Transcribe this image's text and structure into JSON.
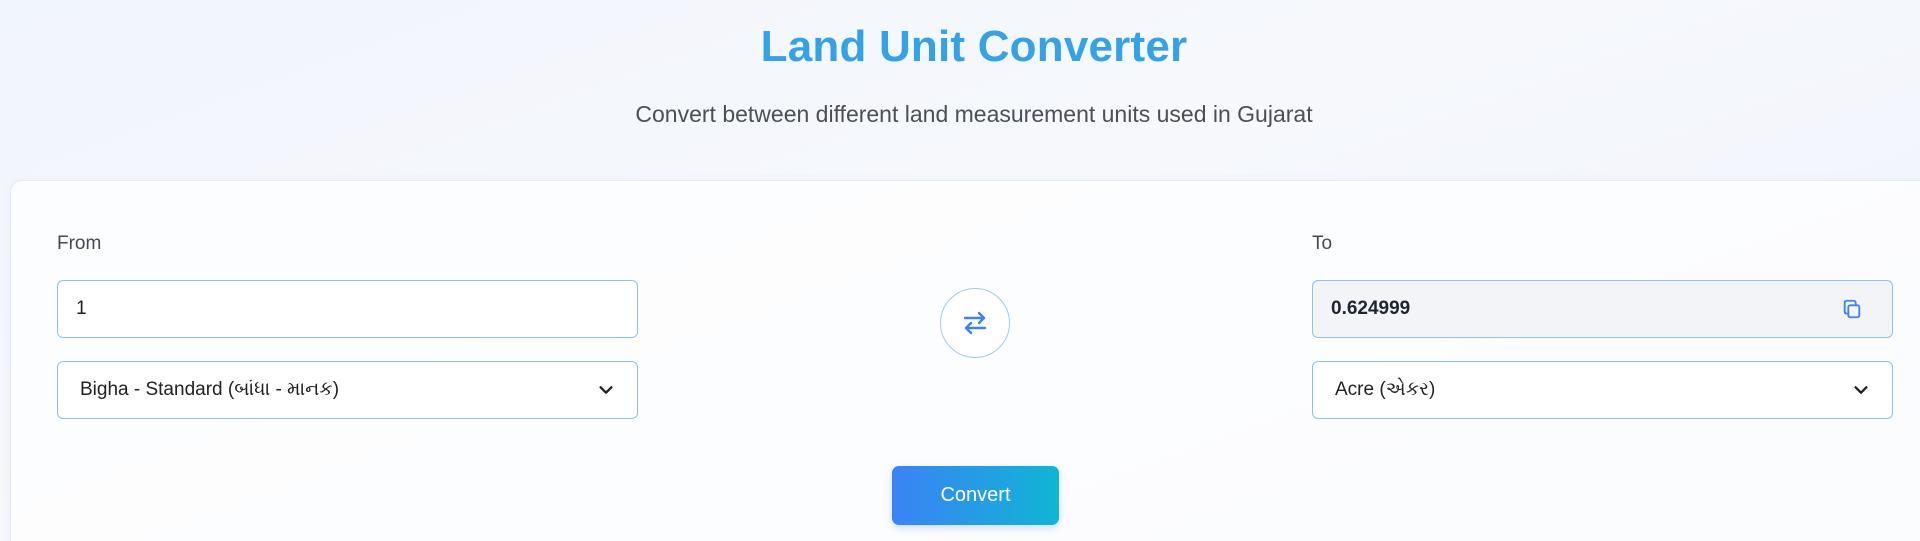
{
  "header": {
    "title": "Land Unit Converter",
    "subtitle": "Convert between different land measurement units used in Gujarat"
  },
  "converter": {
    "from": {
      "label": "From",
      "value": "1",
      "unit_selected": "Bigha - Standard (બાંધા - માનક)"
    },
    "to": {
      "label": "To",
      "value": "0.624999",
      "unit_selected": "Acre (એકર)"
    },
    "swap_icon": "swap-arrows-icon",
    "copy_icon": "copy-icon",
    "convert_label": "Convert"
  },
  "colors": {
    "title": "#33a2e6",
    "accent_blue": "#3b82f6",
    "accent_cyan": "#10b5d4",
    "border": "#8fc1ee"
  }
}
